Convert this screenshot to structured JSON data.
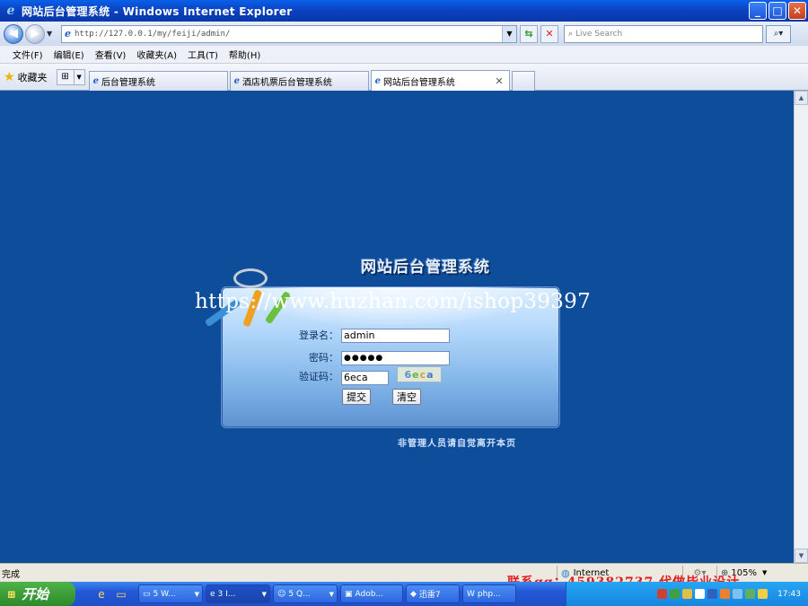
{
  "window": {
    "title": "网站后台管理系统 - Windows Internet Explorer",
    "minimize": "_",
    "maximize": "□",
    "close": "✕"
  },
  "address": {
    "url": "http://127.0.0.1/my/feiji/admin/",
    "search_placeholder": "Live Search"
  },
  "menu": {
    "items": [
      "文件(F)",
      "编辑(E)",
      "查看(V)",
      "收藏夹(A)",
      "工具(T)",
      "帮助(H)"
    ]
  },
  "favorites": {
    "label": "收藏夹"
  },
  "tabs": [
    {
      "label": "后台管理系统",
      "active": false
    },
    {
      "label": "酒店机票后台管理系统",
      "active": false
    },
    {
      "label": "网站后台管理系统",
      "active": true
    }
  ],
  "page": {
    "heading": "网站后台管理系统",
    "watermark_url": "https://www.huzhan.com/ishop39397",
    "username_label": "登录名：",
    "username_value": "admin",
    "password_label": "密码：",
    "password_value": "●●●●●",
    "captcha_label": "验证码：",
    "captcha_value": "6eca",
    "captcha_image_text": [
      "6",
      "e",
      "c",
      "a"
    ],
    "submit_label": "提交",
    "clear_label": "清空",
    "notice": "非管理人员请自觉离开本页"
  },
  "status": {
    "text": "完成",
    "zone": "Internet",
    "zoom": "105%"
  },
  "watermark_contact": "联系qq：459382737 代做毕业设计",
  "taskbar": {
    "start": "开始",
    "items": [
      {
        "label": "5 W...",
        "icon": "folder"
      },
      {
        "label": "3 I...",
        "icon": "ie"
      },
      {
        "label": "5 Q...",
        "icon": "qq"
      },
      {
        "label": "Adob...",
        "icon": "dw"
      },
      {
        "label": "迅雷7",
        "icon": "xunlei"
      },
      {
        "label": "php...",
        "icon": "word"
      }
    ],
    "clock": "17:43"
  },
  "colors": {
    "page_background": "#0e4d9a",
    "titlebar": "#0a3fbd",
    "contact_red": "#e02020"
  }
}
